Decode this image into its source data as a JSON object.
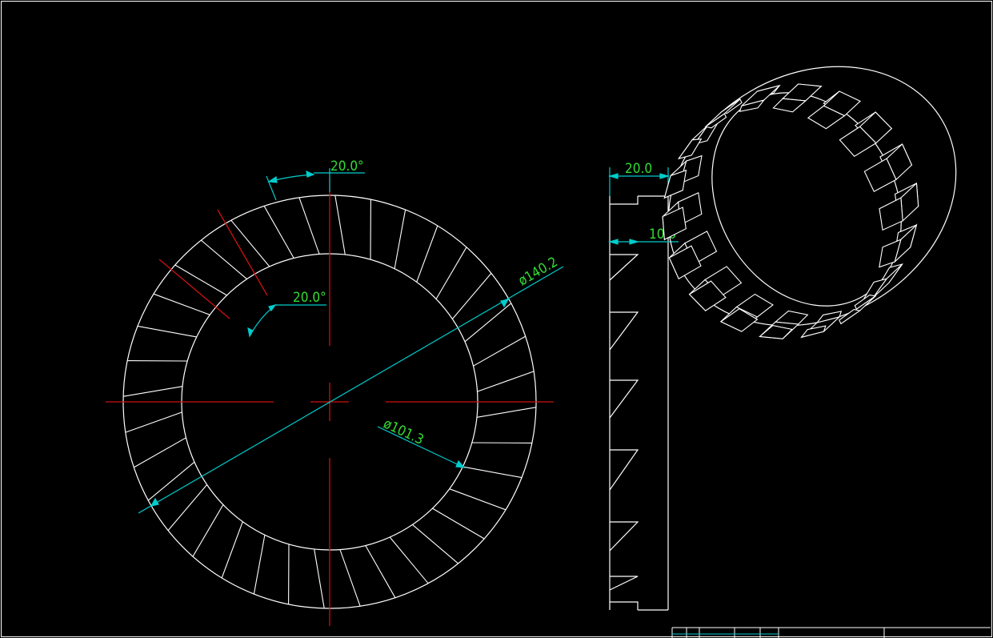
{
  "colors": {
    "background": "#000000",
    "geometry": "#ffffff",
    "centerline": "#cc1111",
    "dimension_line": "#00cccc",
    "dimension_text": "#33dd33"
  },
  "front_view": {
    "tooth_count": 36,
    "angle_dim_outer": "20.0°",
    "angle_dim_inner": "20.0°",
    "diameter_outer": "ø140.2",
    "diameter_inner": "ø101.3"
  },
  "side_view": {
    "width_dim": "20.0",
    "tooth_depth_dim": "10.0"
  },
  "iso_view": {
    "tooth_count": 18
  }
}
